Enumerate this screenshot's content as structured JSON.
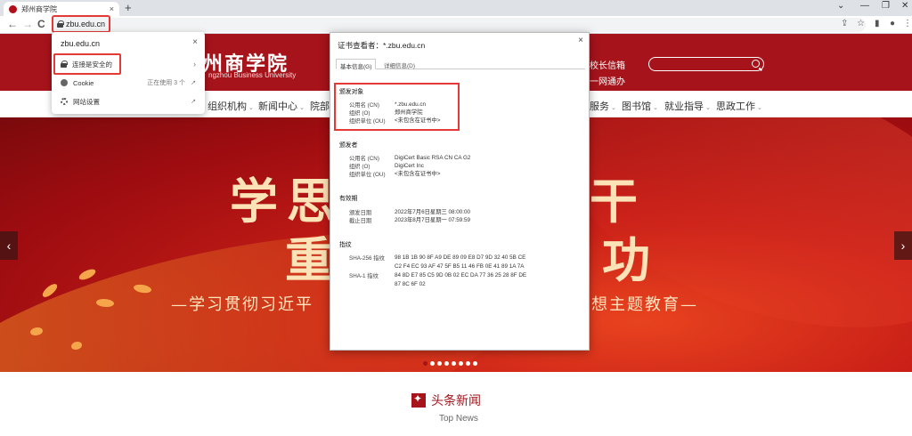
{
  "browser": {
    "tab_title": "郑州商学院",
    "tab_close": "×",
    "new_tab": "+",
    "host": "zbu.edu.cn",
    "window_controls": [
      "⌄",
      "—",
      "❐",
      "✕"
    ],
    "nav": {
      "back": "←",
      "forward": "→",
      "reload": "C"
    }
  },
  "site_info": {
    "host": "zbu.edu.cn",
    "close": "×",
    "connection_label": "连接是安全的",
    "cookie_label": "Cookie",
    "cookie_status": "正在使用 3 个",
    "settings_label": "网站设置"
  },
  "header": {
    "logo_cn": "州商学院",
    "logo_en": "ngzhou Business University",
    "link_principal": "校长信箱",
    "link_onenet": "一网通办"
  },
  "nav": {
    "items": [
      "组织机构",
      "新闻中心",
      "院部",
      "服务",
      "图书馆",
      "就业指导",
      "思政工作"
    ],
    "chevron": "⌄"
  },
  "banner": {
    "line1_left": "学思",
    "line1_right": "干",
    "line2_left": "重",
    "line2_right": "功",
    "sub_left": "—学习贯彻习近平",
    "sub_right": "想主题教育—",
    "prev": "‹",
    "next": "›",
    "slide_count": 8,
    "active_slide": 0
  },
  "news": {
    "title_cn": "头条新闻",
    "title_en": "Top News"
  },
  "certificate": {
    "title": "证书查看者：*.zbu.edu.cn",
    "close": "×",
    "tabs": [
      "基本信息(G)",
      "详细信息(D)"
    ],
    "subject_heading": "颁发对象",
    "subject": [
      {
        "label": "公用名 (CN)",
        "value": "*.zbu.edu.cn"
      },
      {
        "label": "组织 (O)",
        "value": "郑州商学院"
      },
      {
        "label": "组织单位 (OU)",
        "value": "<未包含在证书中>"
      }
    ],
    "issuer_heading": "颁发者",
    "issuer": [
      {
        "label": "公用名 (CN)",
        "value": "DigiCert Basic RSA CN CA G2"
      },
      {
        "label": "组织 (O)",
        "value": "DigiCert Inc"
      },
      {
        "label": "组织单位 (OU)",
        "value": "<未包含在证书中>"
      }
    ],
    "validity_heading": "有效期",
    "validity": [
      {
        "label": "颁发日期",
        "value": "2022年7月6日星期三 08:00:00"
      },
      {
        "label": "截止日期",
        "value": "2023年8月7日星期一 07:59:59"
      }
    ],
    "fingerprint_heading": "指纹",
    "fingerprints": [
      {
        "label": "SHA-256 指纹",
        "value": "98 1B 1B 90 8F A9 DE 89 09 E8 D7 9D 32 40 5B CE C2 F4 EC 93 AF 47 5F B5 11 46 FB 0E 41 89 1A 7A"
      },
      {
        "label": "SHA-1 指纹",
        "value": "84 8D E7 85 C5 9D 0B 02 EC DA 77 36 25 28 8F DE 87 8C 6F 02"
      }
    ]
  },
  "colors": {
    "brand": "#a6131b",
    "highlight": "#e53935"
  }
}
